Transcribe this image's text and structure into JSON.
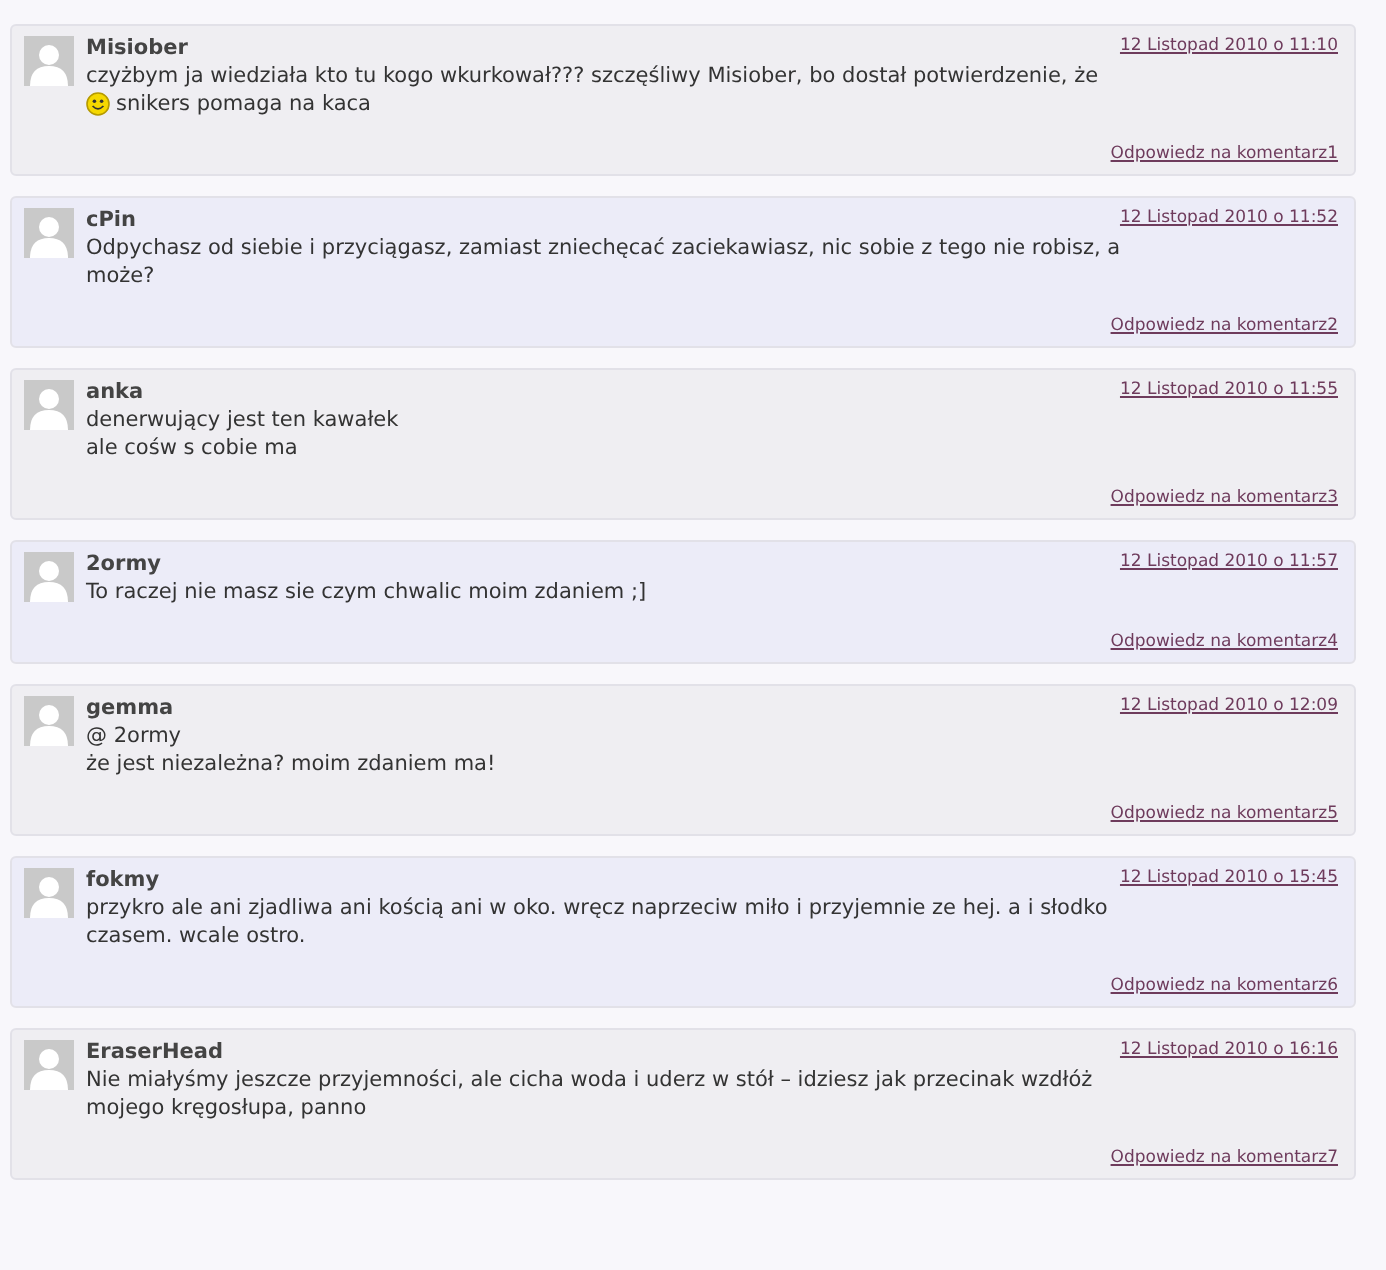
{
  "comments": [
    {
      "author": "Misiober",
      "date": "12 Listopad 2010 o 11:10",
      "lines": [
        {
          "text": "czyżbym ja wiedziała kto tu kogo wkurkował??? szczęśliwy Misiober, bo dostał potwierdzenie, że"
        },
        {
          "text": "snikers pomaga na kaca",
          "emoticon": true
        }
      ],
      "reply": "Odpowiedz na komentarz1"
    },
    {
      "author": "cPin",
      "date": "12 Listopad 2010 o 11:52",
      "lines": [
        {
          "text": "Odpychasz od siebie i przyciągasz, zamiast zniechęcać zaciekawiasz, nic sobie z tego nie robisz, a"
        },
        {
          "text": "może?"
        }
      ],
      "reply": "Odpowiedz na komentarz2"
    },
    {
      "author": "anka",
      "date": "12 Listopad 2010 o 11:55",
      "lines": [
        {
          "text": "denerwujący jest ten kawałek"
        },
        {
          "text": "ale cośw s cobie ma"
        }
      ],
      "reply": "Odpowiedz na komentarz3"
    },
    {
      "author": "2ormy",
      "date": "12 Listopad 2010 o 11:57",
      "lines": [
        {
          "text": "To raczej nie masz sie czym chwalic moim zdaniem ;]"
        }
      ],
      "reply": "Odpowiedz na komentarz4"
    },
    {
      "author": "gemma",
      "date": "12 Listopad 2010 o 12:09",
      "lines": [
        {
          "text": "@ 2ormy"
        },
        {
          "text": "że jest niezależna? moim zdaniem ma!"
        }
      ],
      "reply": "Odpowiedz na komentarz5"
    },
    {
      "author": "fokmy",
      "date": "12 Listopad 2010 o 15:45",
      "lines": [
        {
          "text": "przykro ale ani zjadliwa ani kością ani w oko. wręcz naprzeciw miło i przyjemnie ze hej. a i słodko"
        },
        {
          "text": "czasem. wcale ostro."
        }
      ],
      "reply": "Odpowiedz na komentarz6"
    },
    {
      "author": "EraserHead",
      "date": "12 Listopad 2010 o 16:16",
      "lines": [
        {
          "text": "Nie miałyśmy jeszcze przyjemności, ale cicha woda i uderz w stół – idziesz jak przecinak wzdłóż"
        },
        {
          "text": "mojego kręgosłupa, panno"
        }
      ],
      "reply": "Odpowiedz na komentarz7"
    }
  ]
}
